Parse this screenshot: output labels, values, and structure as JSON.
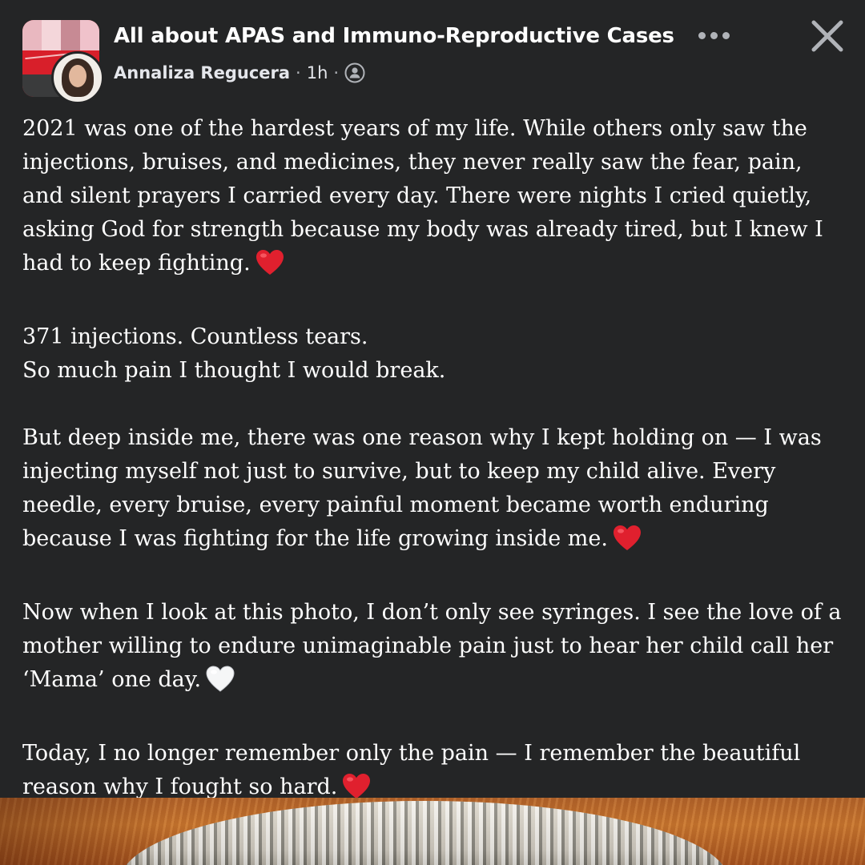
{
  "header": {
    "group_name": "All about APAS and Immuno-Reproductive Cases",
    "author": "Annaliza Regucera",
    "separator": "·",
    "time": "1h",
    "audience_icon": "group-audience-icon",
    "more_icon": "more-options-icon",
    "close_icon": "close-icon"
  },
  "post": {
    "paragraphs": [
      "2021 was one of the hardest years of my life. While others only saw the injections, bruises, and medicines, they never really saw the fear, pain, and silent prayers I carried every day. There were nights I cried quietly, asking God for strength because my body was already tired, but I knew I had to keep fighting.",
      "371 injections. Countless tears.\nSo much pain I thought I would break.",
      "But deep inside me, there was one reason why I kept holding on — I was injecting myself not just to survive, but to keep my child alive. Every needle, every bruise, every painful moment became worth enduring because I was fighting for the life growing inside me.",
      "Now when I look at this photo, I don’t only see syringes. I see the love of a mother willing to endure unimaginable pain just to hear her child call her ‘Mama’ one day.",
      "Today, I no longer remember only the pain — I remember the beautiful reason why I fought so hard."
    ],
    "emojis": [
      "red-heart-emoji",
      "red-heart-emoji",
      "white-heart-emoji",
      "red-heart-emoji"
    ]
  },
  "colors": {
    "background": "#242526",
    "text": "#ffffff",
    "secondary_text": "#b0b3b8",
    "red_heart": "#e0202e",
    "white_heart": "#f5f6f7"
  }
}
